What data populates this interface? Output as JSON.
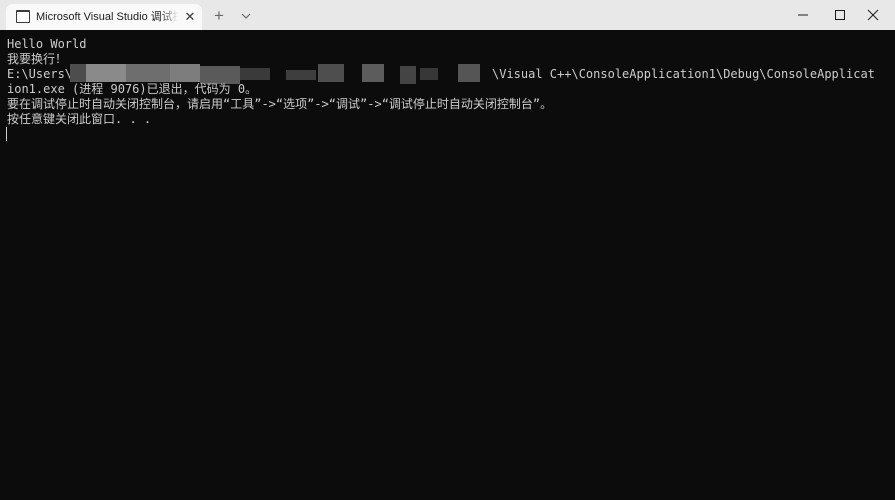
{
  "window": {
    "tab_title": "Microsoft Visual Studio 调试控制台",
    "tab_close_glyph": "✕",
    "new_tab_glyph": "+",
    "icons": {
      "tab": "console-icon",
      "close": "close-icon",
      "new_tab": "plus-icon",
      "dropdown": "chevron-down-icon",
      "minimize": "minimize-icon",
      "maximize": "maximize-icon",
      "window_close": "close-icon"
    }
  },
  "console": {
    "lines": [
      "Hello World",
      "我要换行！",
      "E:\\Users\\",
      "ion1.exe (进程 9076)已退出，代码为 0。",
      "要在调试停止时自动关闭控制台，请启用“工具”->“选项”->“调试”->“调试停止时自动关闭控制台”。",
      "按任意键关闭此窗口. . ."
    ],
    "path_suffix": "\\Visual C++\\ConsoleApplication1\\Debug\\ConsoleApplicat"
  },
  "colors": {
    "background": "#0c0c0c",
    "foreground": "#cccccc",
    "titlebar": "#e8e8e8",
    "active_tab": "#f9f9f9"
  }
}
